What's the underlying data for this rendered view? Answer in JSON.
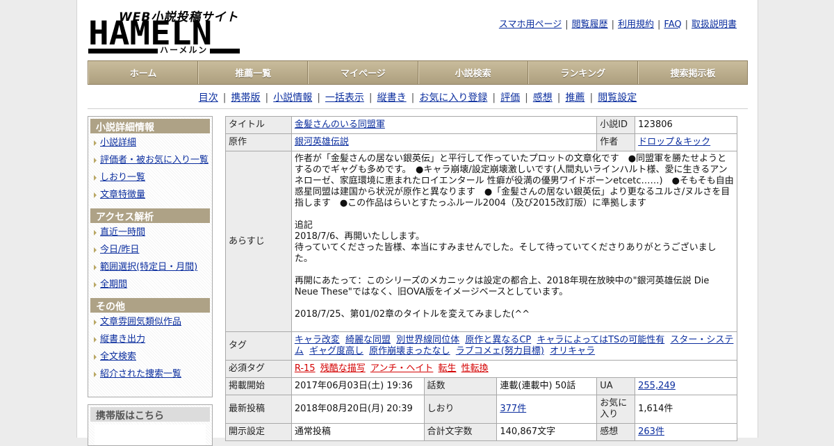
{
  "logo": {
    "sub": "WEB小説投稿サイト",
    "main": "HAMELN",
    "kana": "ハーメルン"
  },
  "top_links": [
    "スマホ用ページ",
    "閲覧履歴",
    "利用規約",
    "FAQ",
    "取扱説明書"
  ],
  "main_nav": [
    "ホーム",
    "推薦一覧",
    "マイページ",
    "小説検索",
    "ランキング",
    "捜索掲示板"
  ],
  "sub_nav": [
    "目次",
    "携帯版",
    "小説情報",
    "一括表示",
    "縦書き",
    "お気に入り登録",
    "評価",
    "感想",
    "推薦",
    "閲覧設定"
  ],
  "sidebar": [
    {
      "heading": "小説詳細情報",
      "items": [
        "小説詳細",
        "評価者・被お気に入り一覧",
        "しおり一覧",
        "文章特徴量"
      ]
    },
    {
      "heading": "アクセス解析",
      "items": [
        "直近一時間",
        "今日/昨日",
        "範囲選択(特定日・月間)",
        "全期間"
      ]
    },
    {
      "heading": "その他",
      "items": [
        "文章雰囲気類似作品",
        "縦書き出力",
        "全文検索",
        "紹介された捜索一覧"
      ]
    }
  ],
  "mobile_box": {
    "heading": "携帯版はこちら"
  },
  "info": {
    "title_label": "タイトル",
    "title": "金髪さんのいる同盟軍",
    "id_label": "小説ID",
    "id": "123806",
    "original_label": "原作",
    "original": "銀河英雄伝説",
    "author_label": "作者",
    "author": "ドロップ＆キック",
    "synopsis_label": "あらすじ",
    "synopsis": [
      "作者が「金髪さんの居ない銀英伝」と平行して作っていたプロットの文章化です　●同盟軍を勝たせようとするのでギャグも多めです。　●キャラ崩壊/設定崩壊激しいです(人間丸いラインハルト様、愛に生きるアンネローゼ、家庭環境に恵まれたロイエンタール 性癖が役満の優男ワイドボーンetcetc……)　●そもそも自由惑星同盟は建国から状況が原作と異なります　●「金髪さんの居ない銀英伝」より更なるユルさ/ヌルさを目指します　●この作品はらいとすたっふルール2004（及び2015改訂版）に準拠します",
      "追記\n2018/7/6、再開いたしします。\n待っていてくださった皆様、本当にすみませんでした。そして待っていてくださりありがとうございました。",
      "再開にあたって：このシリーズのメカニックは設定の都合上、2018年現在放映中の\"銀河英雄伝説 Die Neue These\"ではなく、旧OVA版をイメージベースとしています。",
      "2018/7/25、第01/02章のタイトルを変えてみました(^^"
    ],
    "tags_label": "タグ",
    "tags": [
      "キャラ改変",
      "綺麗な同盟",
      "別世界線同位体",
      "原作と異なるCP",
      "キャラによってはTSの可能性有",
      "スター・システム",
      "ギャグ度高し",
      "原作崩壊まったなし",
      "ラブコメェ(努力目標)",
      "オリキャラ"
    ],
    "required_tags_label": "必須タグ",
    "required_tags": [
      "R-15",
      "残酷な描写",
      "アンチ・ヘイト",
      "転生",
      "性転換"
    ],
    "published_label": "掲載開始",
    "published": "2017年06月03日(土) 19:36",
    "episodes_label": "話数",
    "episodes": "連載(連載中) 50話",
    "ua_label": "UA",
    "ua": "255,249",
    "latest_label": "最新投稿",
    "latest": "2018年08月20日(月) 20:39",
    "bookmarks_label": "しおり",
    "bookmarks": "377件",
    "favorites_label": "お気に入り",
    "favorites": "1,614件",
    "public_label": "開示設定",
    "public": "通常投稿",
    "chars_label": "合計文字数",
    "chars": "140,867文字",
    "reviews_label": "感想",
    "reviews": "263件"
  }
}
